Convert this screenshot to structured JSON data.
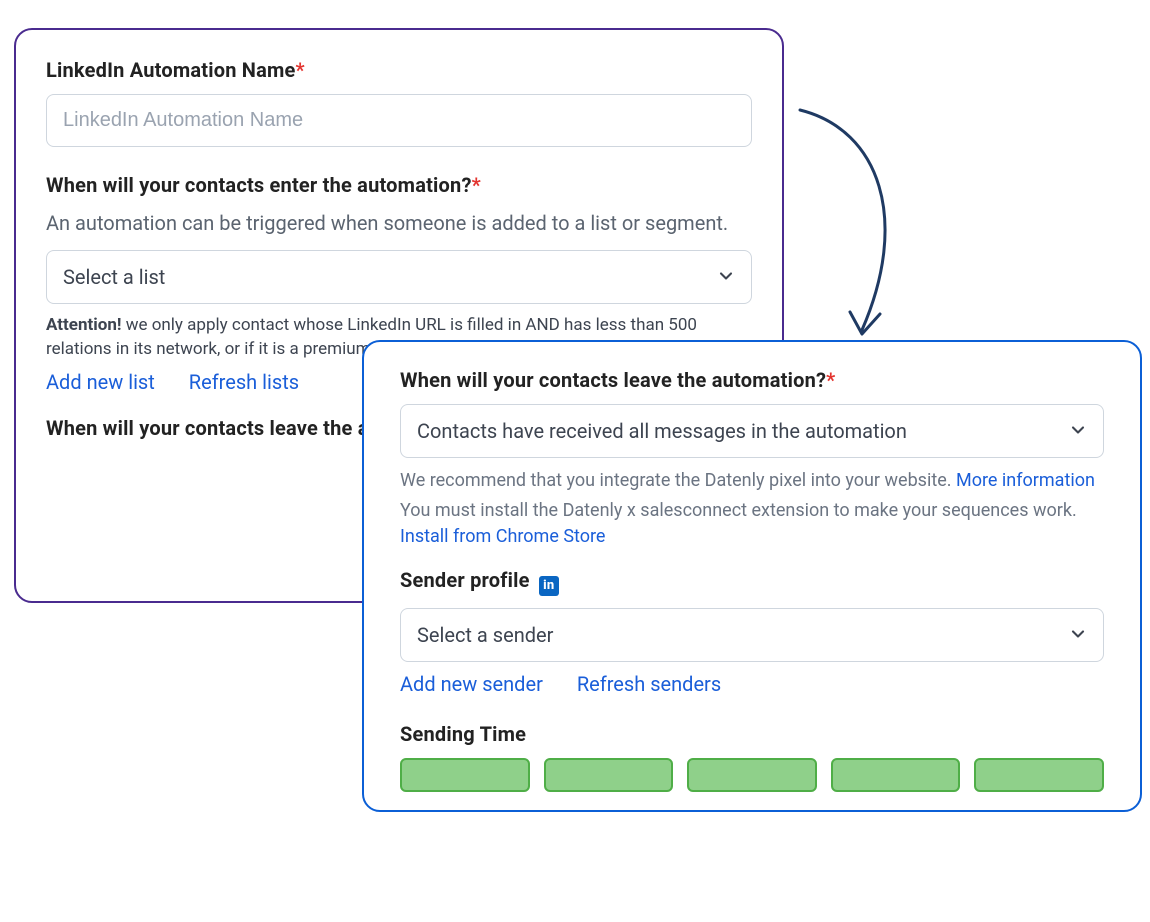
{
  "panelBack": {
    "nameLabel": "LinkedIn Automation Name",
    "namePlaceholder": "LinkedIn Automation Name",
    "enterLabel": "When will your contacts enter the automation?",
    "enterHelper": "An automation can be triggered when someone is added to a list or segment.",
    "selectListPlaceholder": "Select a list",
    "attentionPrefix": "Attention!",
    "attentionText": " we only apply contact whose LinkedIn URL is filled in AND has less than 500 relations in its network, or if it is a premium account.",
    "addNewList": "Add new list",
    "refreshLists": "Refresh lists",
    "leaveLabel": "When will your contacts leave the automation?"
  },
  "panelFront": {
    "leaveLabel": "When will your contacts leave the automation?",
    "leaveSelectValue": "Contacts have received all messages in the automation",
    "pixelHelper": "We recommend that you integrate the Datenly pixel into your website. ",
    "moreInfo": "More information",
    "extHelper": "You must install the Datenly x salesconnect extension to make your sequences work. ",
    "installLink": "Install from Chrome Store",
    "senderLabel": "Sender profile",
    "senderSelectValue": "Select a sender",
    "addNewSender": "Add new sender",
    "refreshSenders": "Refresh senders",
    "sendingTimeLabel": "Sending Time"
  }
}
